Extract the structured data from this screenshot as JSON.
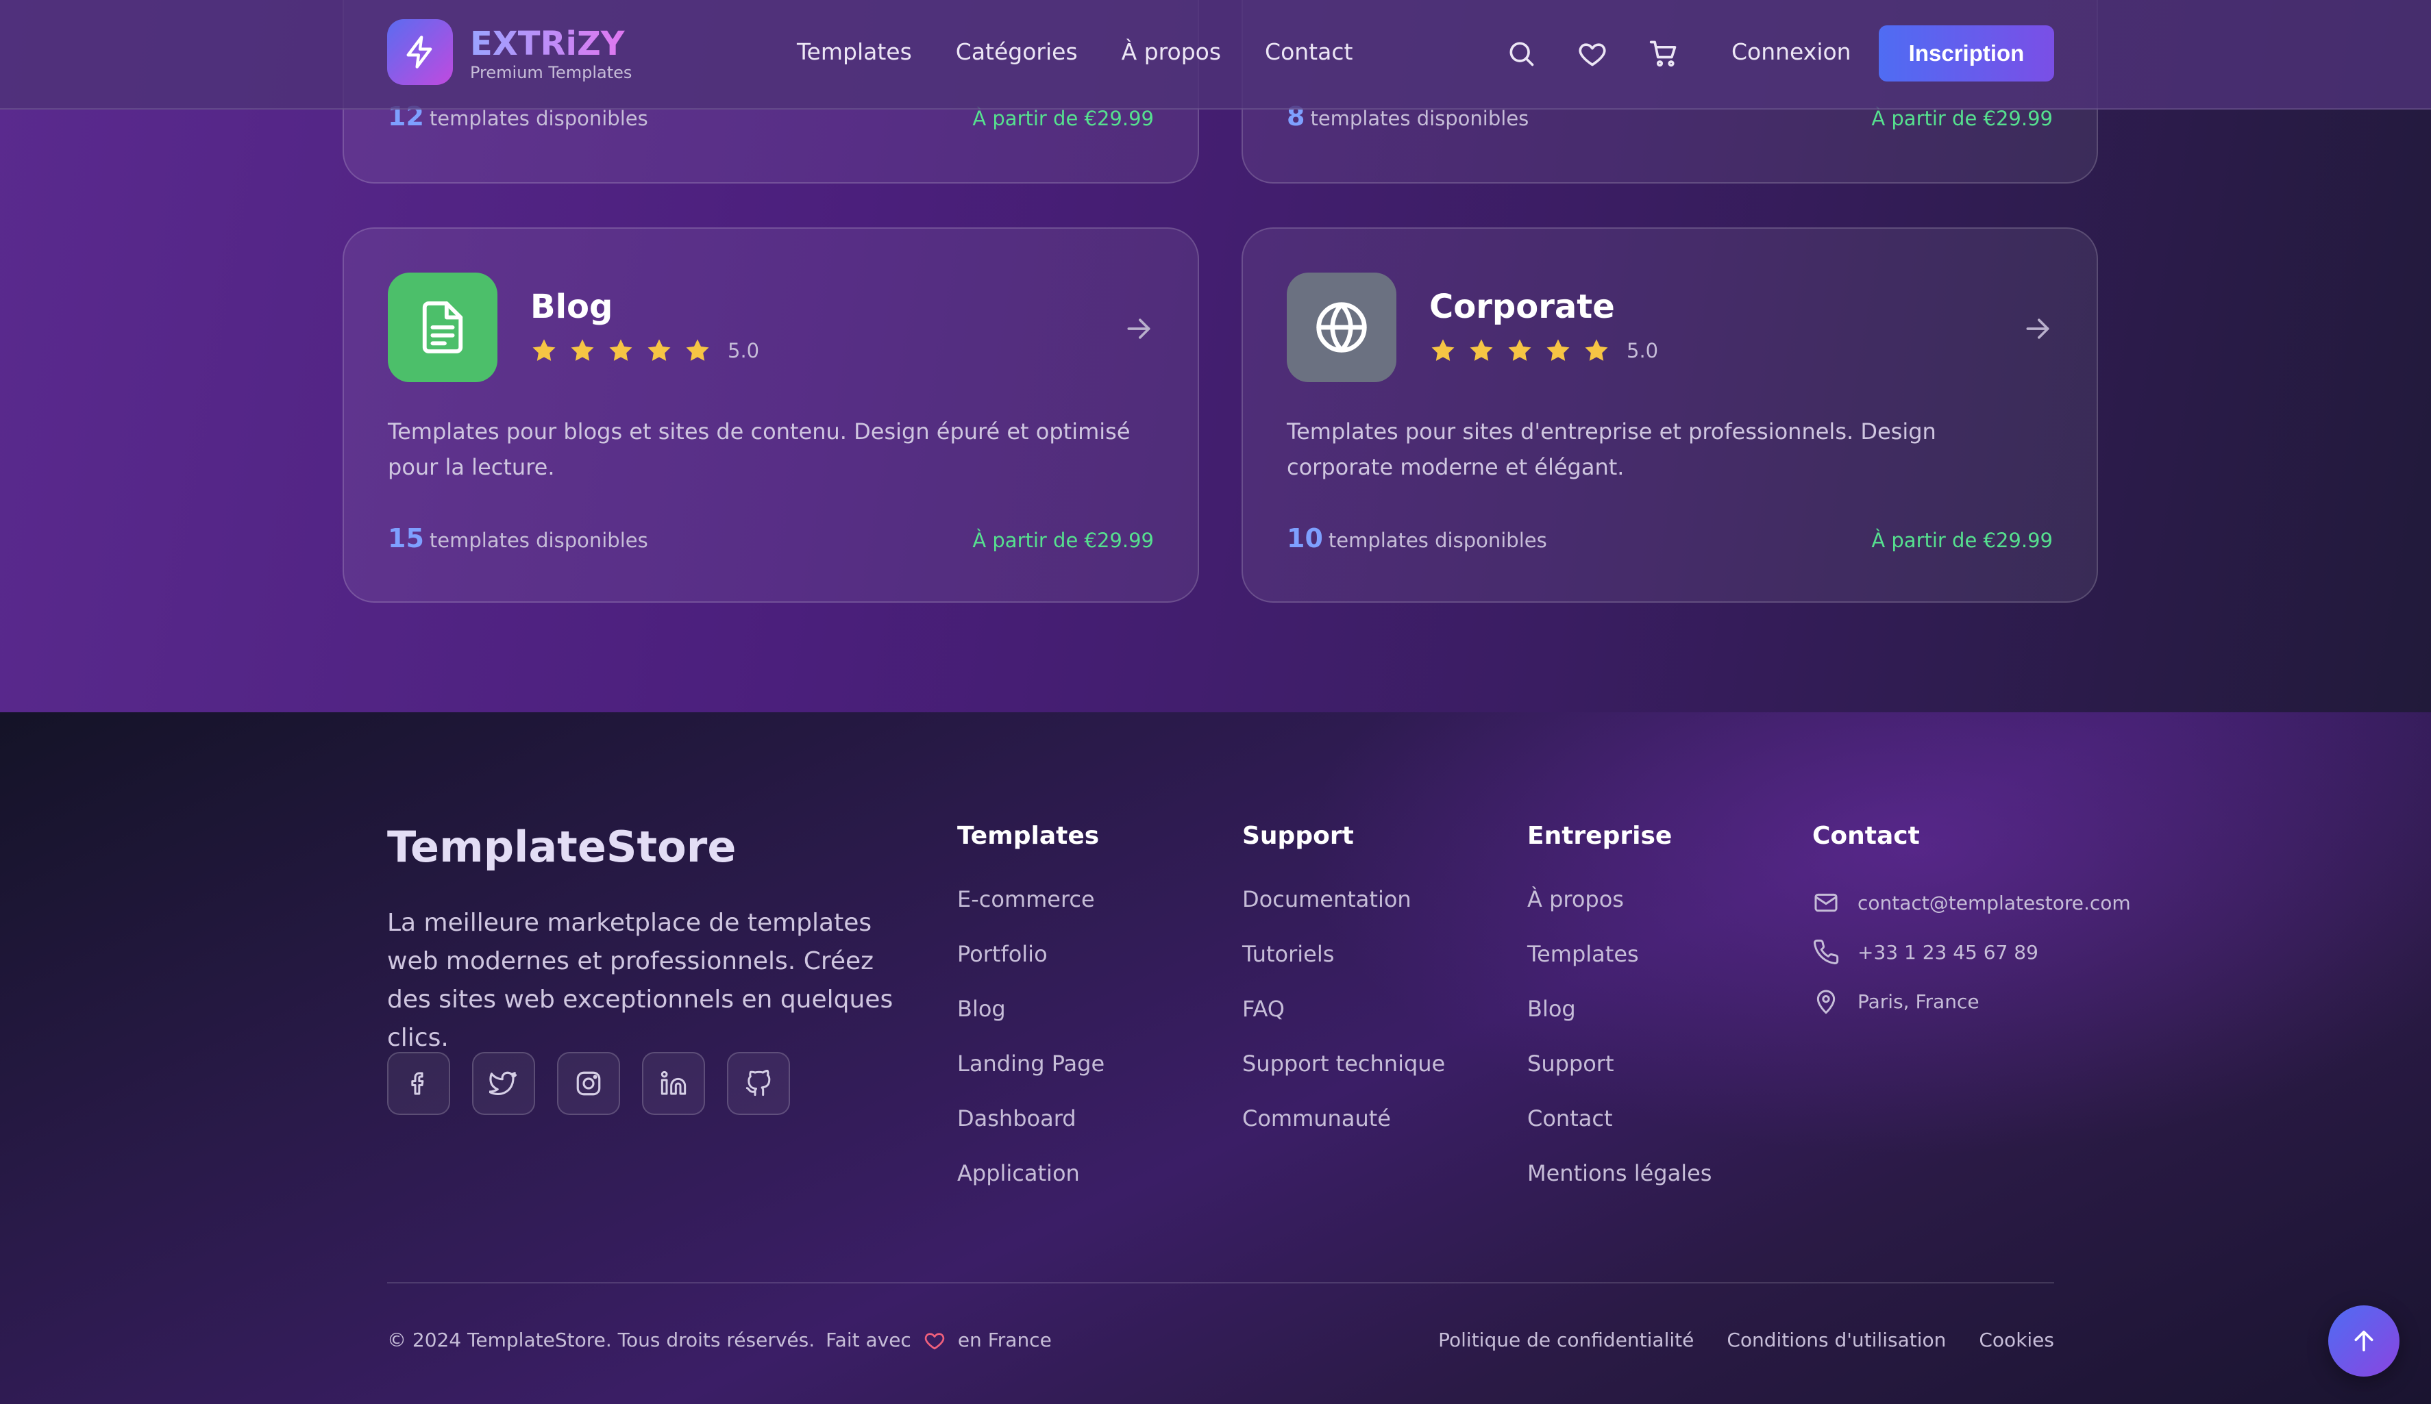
{
  "header": {
    "brand_name": "EXTRiZY",
    "brand_sub": "Premium Templates",
    "nav": [
      "Templates",
      "Catégories",
      "À propos",
      "Contact"
    ],
    "icons": [
      "search-icon",
      "heart-icon",
      "cart-icon"
    ],
    "login": "Connexion",
    "signup": "Inscription",
    "accent": "#4f6cf3"
  },
  "categories": {
    "count_label": "templates disponibles",
    "top": [
      {
        "count": "12",
        "price": "À partir de €29.99"
      },
      {
        "count": "8",
        "price": "À partir de €29.99"
      }
    ],
    "cards": [
      {
        "icon": "document-icon",
        "icon_color": "#4cbf6a",
        "title": "Blog",
        "stars": 5,
        "rating": "5.0",
        "description": "Templates pour blogs et sites de contenu. Design épuré et optimisé pour la lecture.",
        "count": "15",
        "price": "À partir de €29.99"
      },
      {
        "icon": "globe-icon",
        "icon_color": "#6b7181",
        "title": "Corporate",
        "stars": 5,
        "rating": "5.0",
        "description": "Templates pour sites d'entreprise et professionnels. Design corporate moderne et élégant.",
        "count": "10",
        "price": "À partir de €29.99"
      }
    ],
    "star_color": "#f6c544",
    "price_color": "#56e08f"
  },
  "footer": {
    "brand": "TemplateStore",
    "description": "La meilleure marketplace de templates web modernes et professionnels. Créez des sites web exceptionnels en quelques clics.",
    "socials": [
      "facebook-icon",
      "twitter-icon",
      "instagram-icon",
      "linkedin-icon",
      "github-icon"
    ],
    "columns": [
      {
        "title": "Templates",
        "links": [
          "E-commerce",
          "Portfolio",
          "Blog",
          "Landing Page",
          "Dashboard",
          "Application"
        ]
      },
      {
        "title": "Support",
        "links": [
          "Documentation",
          "Tutoriels",
          "FAQ",
          "Support technique",
          "Communauté"
        ]
      },
      {
        "title": "Entreprise",
        "links": [
          "À propos",
          "Templates",
          "Blog",
          "Support",
          "Contact",
          "Mentions légales"
        ]
      }
    ],
    "contact": {
      "title": "Contact",
      "email": "contact@templatestore.com",
      "phone": "+33 1 23 45 67 89",
      "location": "Paris, France"
    },
    "copyright": "© 2024 TemplateStore. Tous droits réservés.",
    "made_with": "Fait avec",
    "made_in": "en France",
    "legal": [
      "Politique de confidentialité",
      "Conditions d'utilisation",
      "Cookies"
    ]
  }
}
